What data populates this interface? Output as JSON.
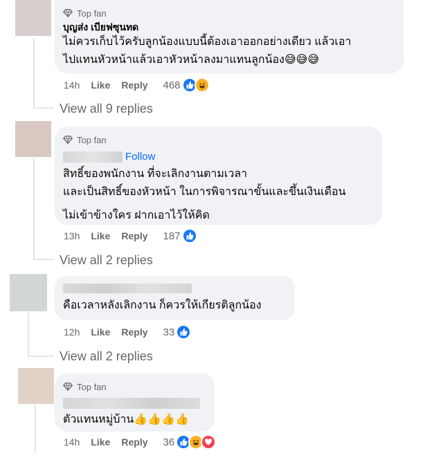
{
  "colors": {
    "like_blue": "#1877f2",
    "haha_yellow": "#f7b125",
    "love_red": "#f33e58",
    "link_blue": "#0866ff"
  },
  "comments": [
    {
      "badge": "Top fan",
      "author": "บุญส่ง เบียฟซุนทด",
      "lines": [
        "ไม่ควรเก็บไว้ครับลูกน้องแบบนี้ต้องเอาออกอย่างเดียว แล้วเอา",
        "ไปแทนหัวหน้าแล้วเอาหัวหน้าลงมาแทนลูกน้อง😅😅😅"
      ],
      "time": "14h",
      "like_label": "Like",
      "reply_label": "Reply",
      "reaction_count": "468",
      "reactions": [
        "like-icon",
        "haha-icon"
      ],
      "view_replies": "View all 9 replies"
    },
    {
      "badge": "Top fan",
      "follow": "Follow",
      "lines": [
        "สิทธิ์ของพนักงาน ที่จะเลิกงานตามเวลา",
        "และเป็นสิทธิ์ของหัวหน้า ในการพิจารณาขั้นและขึ้นเงินเดือน",
        "ไม่เข้าข้างใคร ฝากเอาไว้ให้คิด"
      ],
      "time": "13h",
      "like_label": "Like",
      "reply_label": "Reply",
      "reaction_count": "187",
      "reactions": [
        "like-icon"
      ],
      "view_replies": "View all 2 replies"
    },
    {
      "lines": [
        "คือเวลาหลังเลิกงาน ก็ควรให้เกียรติลูกน้อง"
      ],
      "time": "12h",
      "like_label": "Like",
      "reply_label": "Reply",
      "reaction_count": "33",
      "reactions": [
        "like-icon"
      ],
      "view_replies": "View all 2 replies"
    },
    {
      "badge": "Top fan",
      "lines": [
        "ตัวแทนหมู่บ้าน👍👍👍👍"
      ],
      "time": "14h",
      "like_label": "Like",
      "reply_label": "Reply",
      "reaction_count": "36",
      "reactions": [
        "like-icon",
        "haha-icon",
        "love-icon"
      ]
    }
  ]
}
